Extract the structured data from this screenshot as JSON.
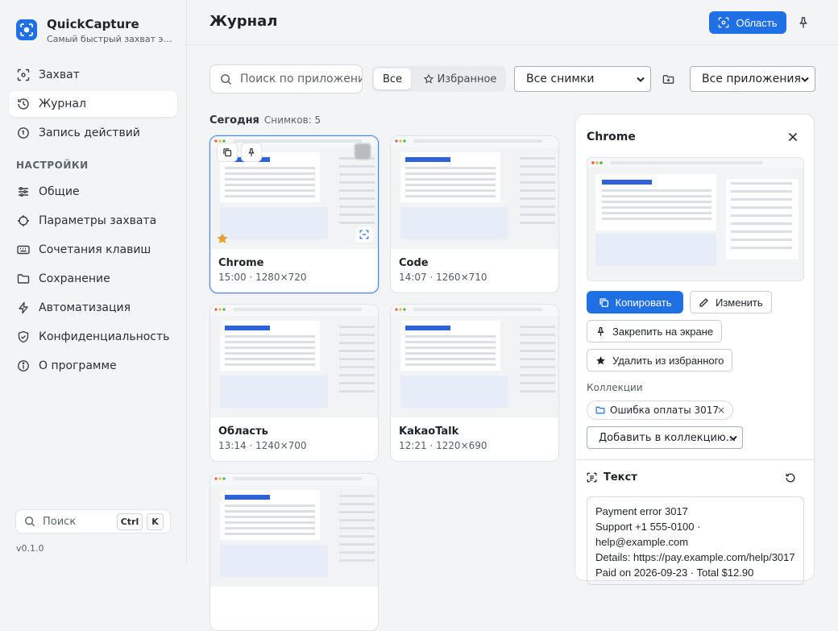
{
  "app": {
    "name": "QuickCapture",
    "tagline": "Самый быстрый захват экрана",
    "version": "v0.1.0"
  },
  "colors": {
    "accent": "#1f6fe5",
    "star": "#f0a020"
  },
  "sidebar": {
    "items": [
      {
        "label": "Захват",
        "icon": "capture-icon"
      },
      {
        "label": "Журнал",
        "icon": "history-icon",
        "active": true
      },
      {
        "label": "Запись действий",
        "icon": "record-icon"
      }
    ],
    "settings_label": "НАСТРОЙКИ",
    "settings": [
      {
        "label": "Общие",
        "icon": "sliders-icon"
      },
      {
        "label": "Параметры захвата",
        "icon": "crosshair-icon"
      },
      {
        "label": "Сочетания клавиш",
        "icon": "keyboard-icon"
      },
      {
        "label": "Сохранение",
        "icon": "folder-icon"
      },
      {
        "label": "Автоматизация",
        "icon": "bolt-icon"
      },
      {
        "label": "Конфиденциальность",
        "icon": "shield-icon"
      },
      {
        "label": "О программе",
        "icon": "info-icon"
      }
    ],
    "search_label": "Поиск",
    "shortcut": [
      "Ctrl",
      "K"
    ]
  },
  "header": {
    "title": "Журнал",
    "region_button": "Область"
  },
  "toolbar": {
    "search_placeholder": "Поиск по приложению, тексту",
    "filter_all": "Все",
    "filter_fav": "Избранное",
    "type_select": "Все снимки",
    "app_select": "Все приложения"
  },
  "group": {
    "title": "Сегодня",
    "count": "Снимков: 5"
  },
  "cards": [
    {
      "name": "Chrome",
      "meta": "15:00 · 1280×720",
      "selected": true,
      "favorite": true
    },
    {
      "name": "Code",
      "meta": "14:07 · 1260×710"
    },
    {
      "name": "Область",
      "meta": "13:14 · 1240×700"
    },
    {
      "name": "KakaoTalk",
      "meta": "12:21 · 1220×690"
    },
    {
      "name": "",
      "meta": ""
    }
  ],
  "detail": {
    "title": "Chrome",
    "copy": "Копировать",
    "edit": "Изменить",
    "pin": "Закрепить на экране",
    "unfav": "Удалить из избранного",
    "collections_label": "Коллекции",
    "collection_chip": "Ошибка оплаты 3017",
    "add_collection": "Добавить в коллекцию...",
    "text_title": "Текст",
    "ocr_lines": [
      "Payment error 3017",
      "Support +1 555-0100 · help@example.com",
      "Details: https://pay.example.com/help/3017",
      "Paid on 2026-09-23 · Total $12.90"
    ]
  }
}
